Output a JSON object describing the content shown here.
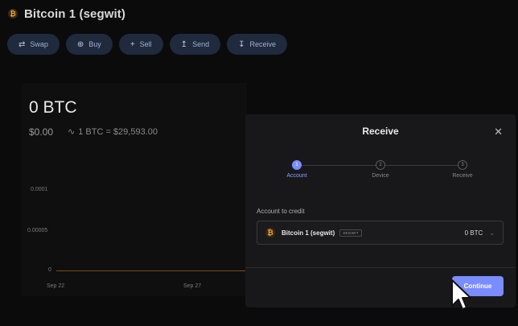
{
  "header": {
    "title": "Bitcoin 1 (segwit)",
    "coin_symbol": "₿"
  },
  "actions": [
    {
      "label": "Swap",
      "icon": "⇄",
      "icon_name": "swap-icon"
    },
    {
      "label": "Buy",
      "icon": "⊕",
      "icon_name": "buy-icon"
    },
    {
      "label": "Sell",
      "icon": "+",
      "icon_name": "sell-icon"
    },
    {
      "label": "Send",
      "icon": "↥",
      "icon_name": "send-icon"
    },
    {
      "label": "Receive",
      "icon": "↧",
      "icon_name": "receive-icon"
    }
  ],
  "summary": {
    "balance": "0 BTC",
    "fiat": "$0.00",
    "rate_icon": "∿",
    "rate": "1 BTC = $29,593.00"
  },
  "chart": {
    "y_ticks": [
      "0.0001",
      "0.00005",
      "0"
    ],
    "x_ticks": [
      "Sep 22",
      "Sep 27"
    ]
  },
  "modal": {
    "title": "Receive",
    "close": "✕",
    "steps": [
      {
        "number": "1",
        "label": "Account",
        "active": true
      },
      {
        "number": "2",
        "label": "Device",
        "active": false
      },
      {
        "number": "3",
        "label": "Receive",
        "active": false
      }
    ],
    "credit_label": "Account to credit",
    "account": {
      "icon": "₿",
      "name": "Bitcoin 1 (segwit)",
      "badge": "SEGWIT",
      "balance": "0 BTC",
      "chevron": "⌄"
    },
    "continue_label": "Continue"
  },
  "colors": {
    "accent": "#7b8cff",
    "bitcoin": "#f0a43a",
    "action_button_bg": "#1f2a3d"
  }
}
